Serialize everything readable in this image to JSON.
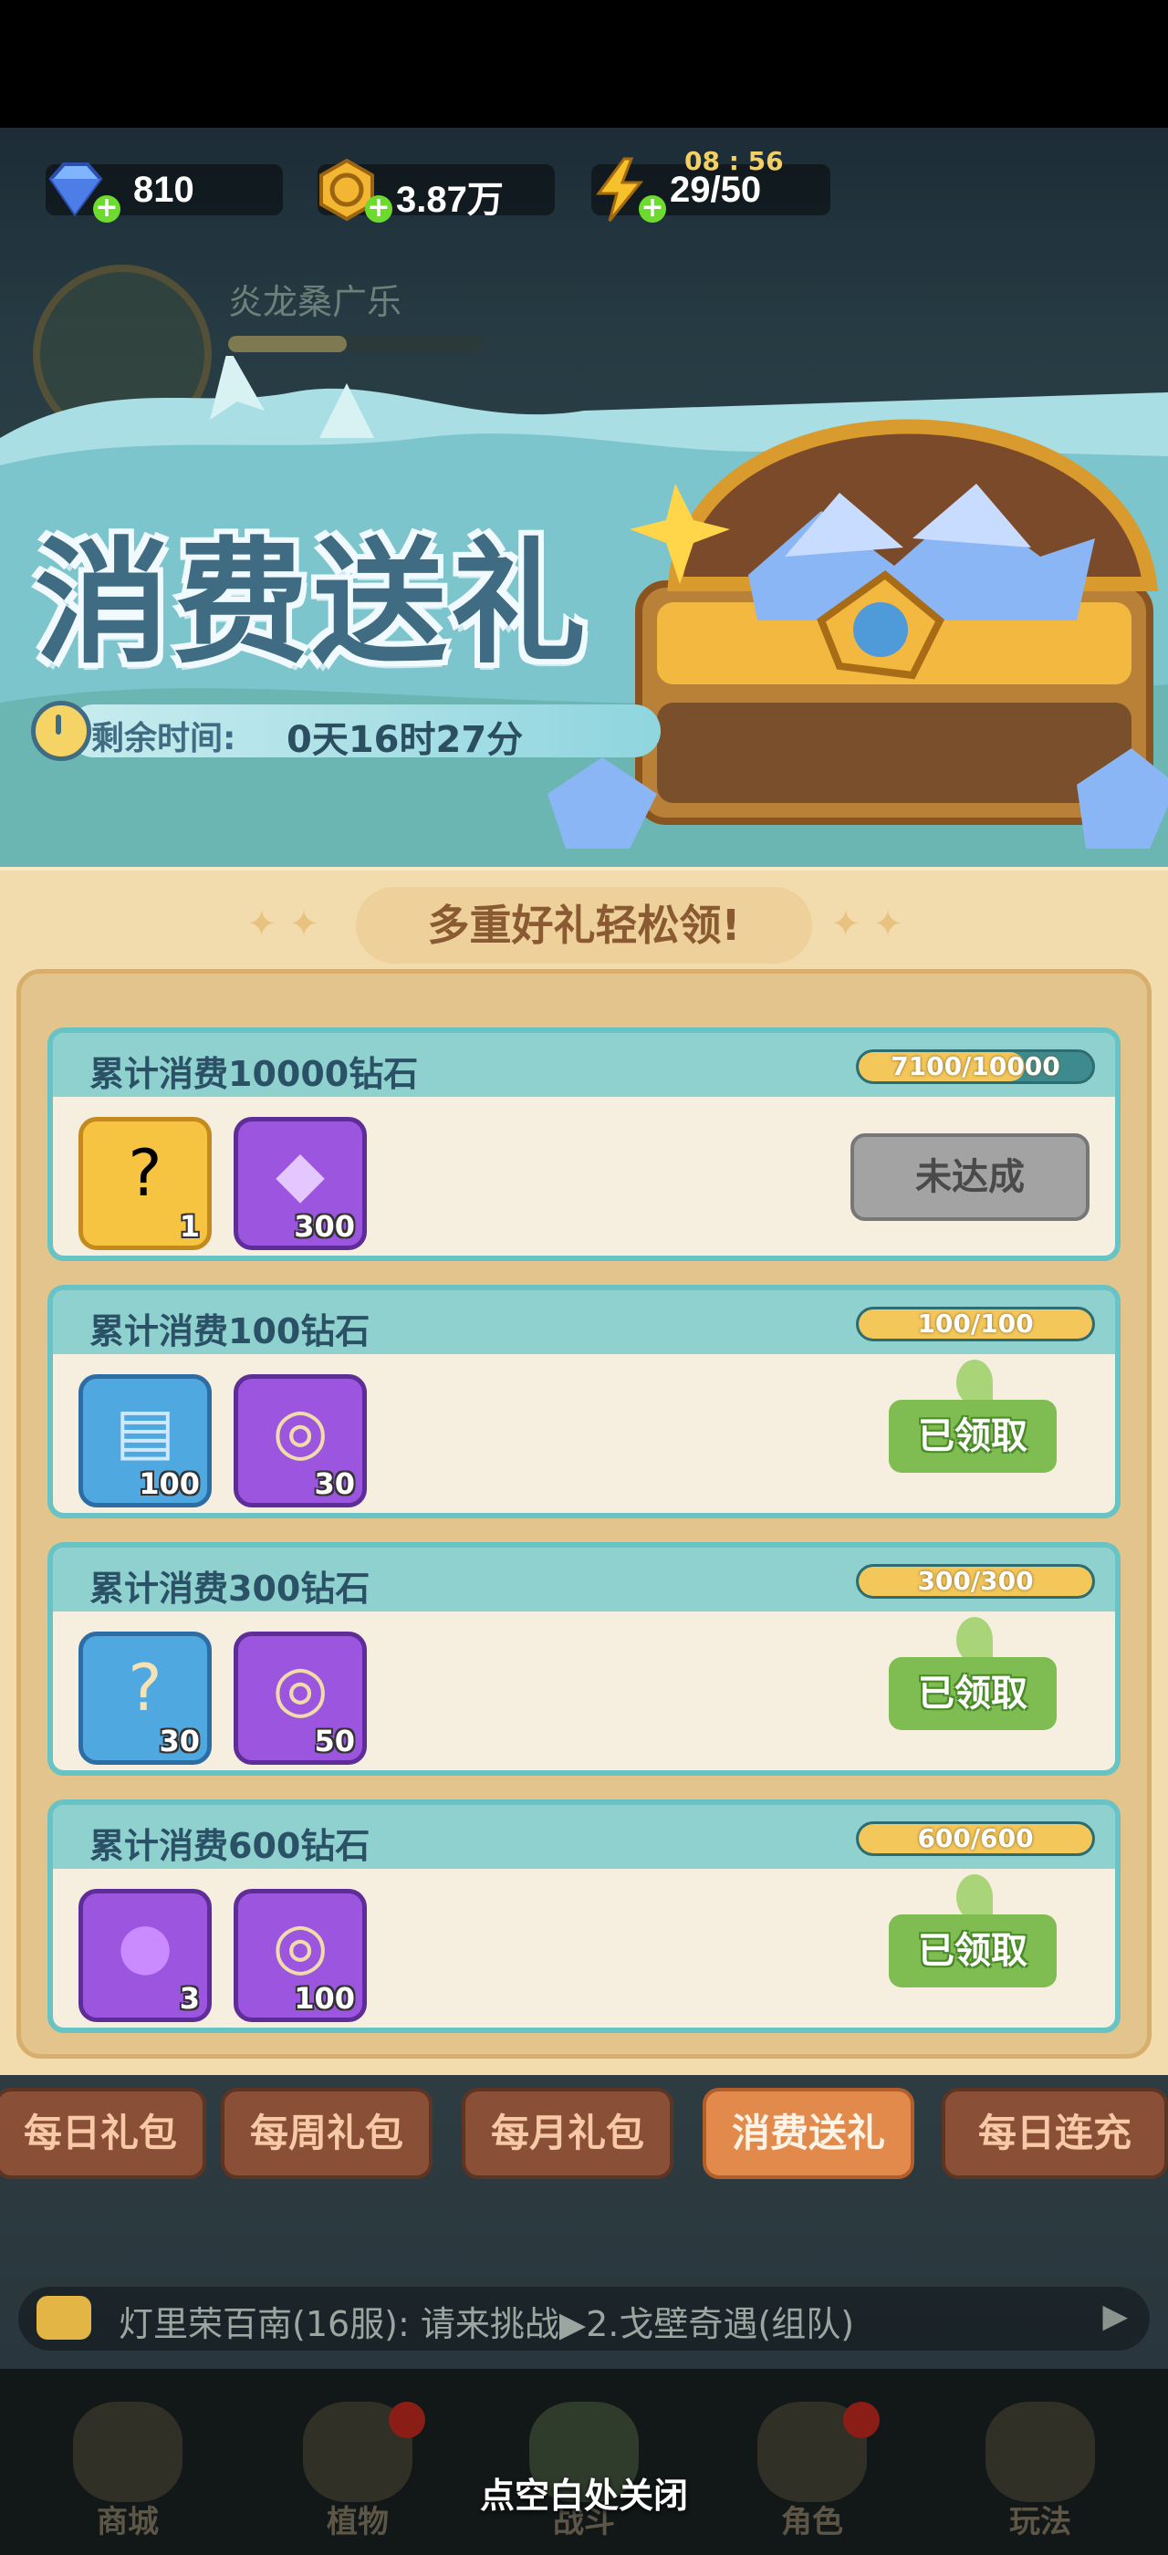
{
  "resources": {
    "diamond": {
      "value": "810",
      "icon": "diamond-icon"
    },
    "gold": {
      "value": "3.87万",
      "icon": "gold-coin-icon"
    },
    "energy": {
      "value": "29/50",
      "timer": "08 : 56",
      "icon": "lightning-icon"
    }
  },
  "background": {
    "player_name": "炎龙桑广乐"
  },
  "banner": {
    "title": "消费送礼",
    "countdown_label": "剩余时间:",
    "countdown_value": "0天16时27分"
  },
  "panel": {
    "ribbon": "多重好礼轻松领!",
    "tasks": [
      {
        "title": "累计消费10000钻石",
        "progress_text": "7100/10000",
        "progress": 0.71,
        "rewards": [
          {
            "icon": "mystery-chest-icon",
            "count": "1",
            "frame": "gold"
          },
          {
            "icon": "purple-crystal-icon",
            "count": "300",
            "frame": "purple"
          }
        ],
        "button": "未达成",
        "state": "locked"
      },
      {
        "title": "累计消费100钻石",
        "progress_text": "100/100",
        "progress": 1.0,
        "rewards": [
          {
            "icon": "blue-book-icon",
            "count": "100",
            "frame": "blue"
          },
          {
            "icon": "scroll-coin-icon",
            "count": "30",
            "frame": "purple"
          }
        ],
        "button": "已领取",
        "state": "claimed"
      },
      {
        "title": "累计消费300钻石",
        "progress_text": "300/300",
        "progress": 1.0,
        "rewards": [
          {
            "icon": "mystery-map-icon",
            "count": "30",
            "frame": "blue"
          },
          {
            "icon": "scroll-coin-icon",
            "count": "50",
            "frame": "purple"
          }
        ],
        "button": "已领取",
        "state": "claimed"
      },
      {
        "title": "累计消费600钻石",
        "progress_text": "600/600",
        "progress": 1.0,
        "rewards": [
          {
            "icon": "purple-potion-icon",
            "count": "3",
            "frame": "purple"
          },
          {
            "icon": "scroll-coin-icon",
            "count": "100",
            "frame": "purple"
          }
        ],
        "button": "已领取",
        "state": "claimed"
      }
    ]
  },
  "tabs": [
    {
      "label": "每日礼包",
      "active": false
    },
    {
      "label": "每周礼包",
      "active": false
    },
    {
      "label": "每月礼包",
      "active": false
    },
    {
      "label": "消费送礼",
      "active": true
    },
    {
      "label": "每日连充",
      "active": false
    }
  ],
  "chat": {
    "text": "灯里荣百南(16服): 请来挑战▶2.戈壁奇遇(组队)"
  },
  "nav": [
    {
      "label": "商城"
    },
    {
      "label": "植物"
    },
    {
      "label": "战斗"
    },
    {
      "label": "角色"
    },
    {
      "label": "玩法"
    }
  ],
  "close_hint": "点空白处关闭"
}
